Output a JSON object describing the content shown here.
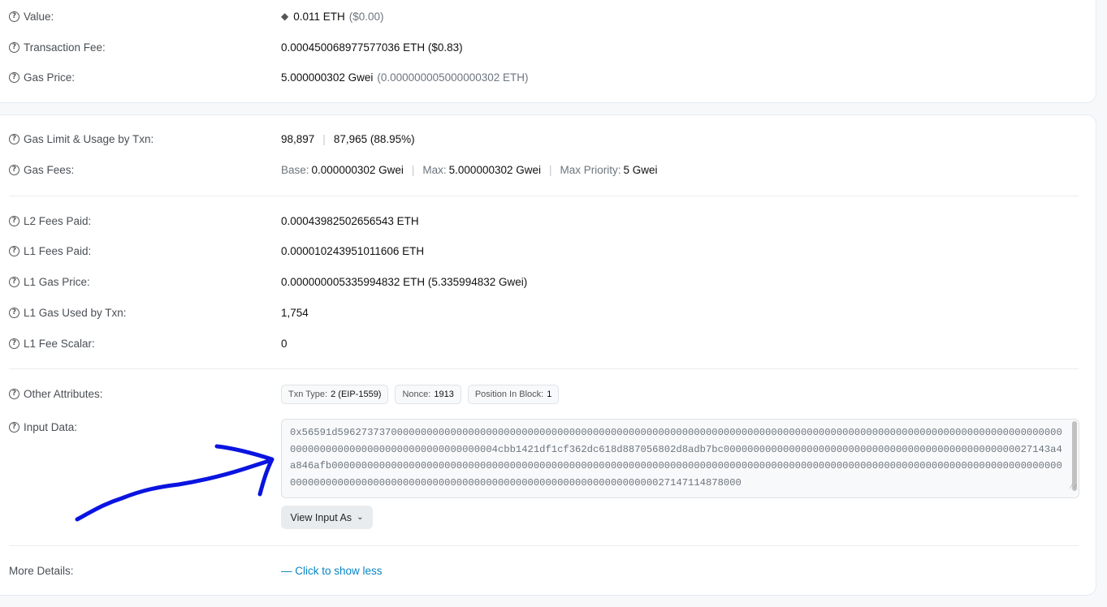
{
  "summary": {
    "value_label": "Value:",
    "value_amount": "0.011 ETH",
    "value_usd": "($0.00)",
    "fee_label": "Transaction Fee:",
    "fee_value": "0.000450068977577036 ETH ($0.83)",
    "gas_price_label": "Gas Price:",
    "gas_price_gwei": "5.000000302 Gwei",
    "gas_price_eth": "(0.000000005000000302 ETH)"
  },
  "gas": {
    "limit_label": "Gas Limit & Usage by Txn:",
    "limit_value": "98,897",
    "usage_value": "87,965 (88.95%)",
    "fees_label": "Gas Fees:",
    "base_label": "Base:",
    "base_value": "0.000000302 Gwei",
    "max_label": "Max:",
    "max_value": "5.000000302 Gwei",
    "priority_label": "Max Priority:",
    "priority_value": "5 Gwei"
  },
  "l2": {
    "l2_fees_label": "L2 Fees Paid:",
    "l2_fees_value": "0.00043982502656543 ETH",
    "l1_fees_label": "L1 Fees Paid:",
    "l1_fees_value": "0.000010243951011606 ETH",
    "l1_gas_price_label": "L1 Gas Price:",
    "l1_gas_price_value": "0.000000005335994832 ETH (5.335994832 Gwei)",
    "l1_gas_used_label": "L1 Gas Used by Txn:",
    "l1_gas_used_value": "1,754",
    "l1_fee_scalar_label": "L1 Fee Scalar:",
    "l1_fee_scalar_value": "0"
  },
  "attributes": {
    "label": "Other Attributes:",
    "txn_type_label": "Txn Type:",
    "txn_type_value": "2 (EIP-1559)",
    "nonce_label": "Nonce:",
    "nonce_value": "1913",
    "position_label": "Position In Block:",
    "position_value": "1"
  },
  "input": {
    "label": "Input Data:",
    "data": "0x56591d5962737370000000000000000000000000000000000000000000000000000000000000000000000000000000000000000000000000000000000000000000000000000000000000000000000000004cbb1421df1cf362dc618d887056802d8adb7bc0000000000000000000000000000000000000000000000000027143a4a846afb0000000000000000000000000000000000000000000000000000000000000000000000000000000000000000000000000000000000000000000000000000000000000000000000000000000000000000000000000000000000000000027147114878000",
    "view_button": "View Input As"
  },
  "more": {
    "label": "More Details:",
    "link": "— Click to show less"
  },
  "colors": {
    "link": "#0784c3",
    "annotation_arrow": "#0a14e0"
  }
}
